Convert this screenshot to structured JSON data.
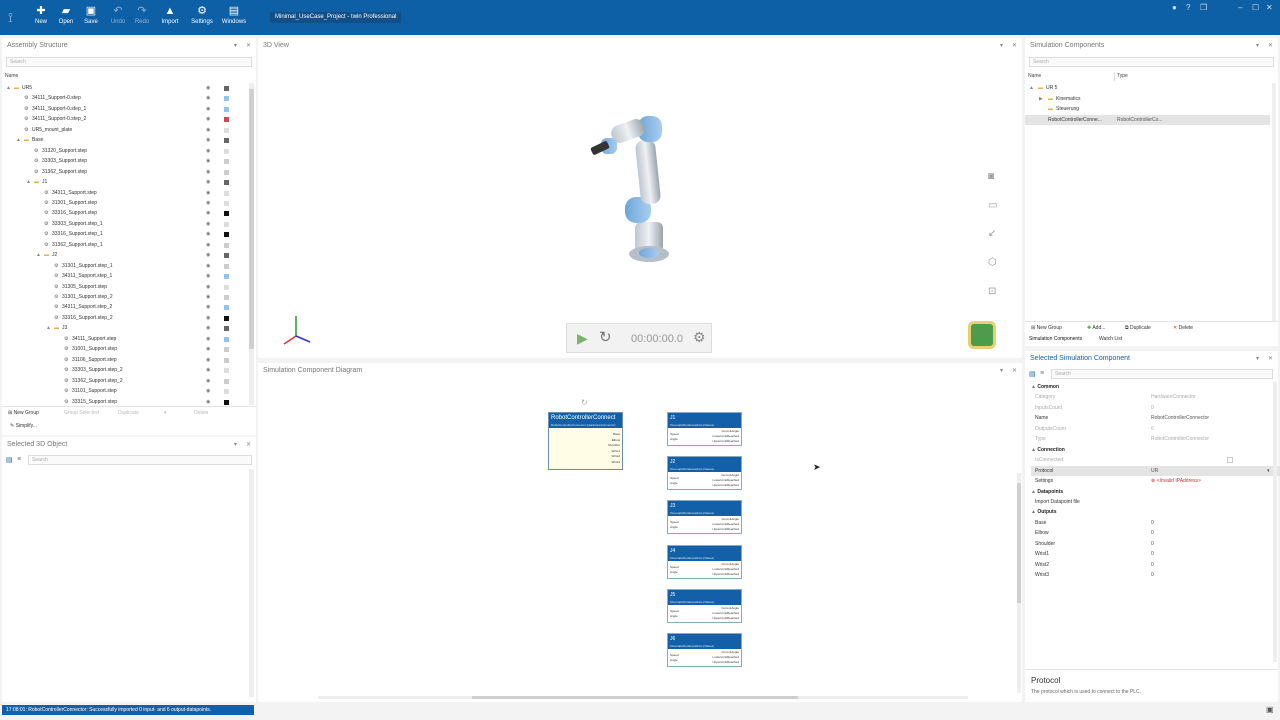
{
  "ribbon": {
    "buttons": [
      {
        "label": "New",
        "icon": "new-icon",
        "glyph": "✚"
      },
      {
        "label": "Open",
        "icon": "folder-icon",
        "glyph": "▰"
      },
      {
        "label": "Save",
        "icon": "save-icon",
        "glyph": "▣"
      },
      {
        "label": "Undo",
        "icon": "undo-icon",
        "glyph": "↶"
      },
      {
        "label": "Redo",
        "icon": "redo-icon",
        "glyph": "↷"
      },
      {
        "label": "Import",
        "icon": "import-icon",
        "glyph": "▲"
      },
      {
        "label": "Settings",
        "icon": "gear-icon",
        "glyph": "⚙"
      },
      {
        "label": "Windows",
        "icon": "windows-icon",
        "glyph": "▤"
      }
    ],
    "title": "Minimal_UseCase_Project - twin Professional"
  },
  "assembly": {
    "title": "Assembly Structure",
    "search_placeholder": "Search",
    "col_name": "Name",
    "rows": [
      {
        "label": "UR5",
        "depth": 0,
        "twisty": "▲",
        "type": "folder",
        "color": "#666666"
      },
      {
        "label": "34111_Support-0.step",
        "depth": 1,
        "twisty": "",
        "type": "part",
        "color": "#8ec4f0"
      },
      {
        "label": "34111_Support-0.step_1",
        "depth": 1,
        "twisty": "",
        "type": "part",
        "color": "#8ec4f0"
      },
      {
        "label": "34111_Support-0.step_2",
        "depth": 1,
        "twisty": "",
        "type": "part",
        "color": "#c05050"
      },
      {
        "label": "UR5_mount_plate",
        "depth": 1,
        "twisty": "",
        "type": "part",
        "color": "#dddddd"
      },
      {
        "label": "Base",
        "depth": 1,
        "twisty": "▲",
        "type": "folder",
        "color": "#666666"
      },
      {
        "label": "31320_Support.step",
        "depth": 2,
        "twisty": "",
        "type": "part",
        "color": "#dddddd"
      },
      {
        "label": "33303_Support.step",
        "depth": 2,
        "twisty": "",
        "type": "part",
        "color": "#cccccc"
      },
      {
        "label": "31362_Support.step",
        "depth": 2,
        "twisty": "",
        "type": "part",
        "color": "#cccccc"
      },
      {
        "label": "J1",
        "depth": 2,
        "twisty": "▲",
        "type": "folder",
        "color": "#666666"
      },
      {
        "label": "34311_Support.step",
        "depth": 3,
        "twisty": "",
        "type": "part",
        "color": "#dddddd"
      },
      {
        "label": "31301_Support.step",
        "depth": 3,
        "twisty": "",
        "type": "part",
        "color": "#dddddd"
      },
      {
        "label": "33316_Support.step",
        "depth": 3,
        "twisty": "",
        "type": "part",
        "color": "#111111"
      },
      {
        "label": "33303_Support.step_1",
        "depth": 3,
        "twisty": "",
        "type": "part",
        "color": "#dddddd"
      },
      {
        "label": "33316_Support.step_1",
        "depth": 3,
        "twisty": "",
        "type": "part",
        "color": "#111111"
      },
      {
        "label": "31362_Support.step_1",
        "depth": 3,
        "twisty": "",
        "type": "part",
        "color": "#cccccc"
      },
      {
        "label": "J2",
        "depth": 3,
        "twisty": "▲",
        "type": "folder",
        "color": "#666666"
      },
      {
        "label": "31301_Support.step_1",
        "depth": 4,
        "twisty": "",
        "type": "part",
        "color": "#cccccc"
      },
      {
        "label": "34311_Support.step_1",
        "depth": 4,
        "twisty": "",
        "type": "part",
        "color": "#8ec4f0"
      },
      {
        "label": "31305_Support.step",
        "depth": 4,
        "twisty": "",
        "type": "part",
        "color": "#dddddd"
      },
      {
        "label": "31301_Support.step_2",
        "depth": 4,
        "twisty": "",
        "type": "part",
        "color": "#cccccc"
      },
      {
        "label": "34311_Support.step_2",
        "depth": 4,
        "twisty": "",
        "type": "part",
        "color": "#8ec4f0"
      },
      {
        "label": "33316_Support.step_2",
        "depth": 4,
        "twisty": "",
        "type": "part",
        "color": "#111111"
      },
      {
        "label": "J3",
        "depth": 4,
        "twisty": "▲",
        "type": "folder",
        "color": "#666666"
      },
      {
        "label": "34111_Support.step",
        "depth": 5,
        "twisty": "",
        "type": "part",
        "color": "#8ec4f0"
      },
      {
        "label": "31001_Support.step",
        "depth": 5,
        "twisty": "",
        "type": "part",
        "color": "#cccccc"
      },
      {
        "label": "31106_Support.step",
        "depth": 5,
        "twisty": "",
        "type": "part",
        "color": "#cccccc"
      },
      {
        "label": "33303_Support.step_2",
        "depth": 5,
        "twisty": "",
        "type": "part",
        "color": "#dddddd"
      },
      {
        "label": "31362_Support.step_2",
        "depth": 5,
        "twisty": "",
        "type": "part",
        "color": "#cccccc"
      },
      {
        "label": "31101_Support.step",
        "depth": 5,
        "twisty": "",
        "type": "part",
        "color": "#dddddd"
      },
      {
        "label": "33315_Support.step",
        "depth": 5,
        "twisty": "",
        "type": "part",
        "color": "#111111"
      }
    ],
    "toolbar": {
      "new_group": "New Group",
      "group_selected": "Group Selected",
      "duplicate": "Duplicate",
      "delete": "Delete",
      "simplify": "Simplify..."
    }
  },
  "selected3d": {
    "title": "Selected 3D Object",
    "search_placeholder": "Search"
  },
  "view3d": {
    "title": "3D View",
    "time": "00:00:00.0"
  },
  "diagram": {
    "title": "Simulation Component Diagram",
    "controller": {
      "title": "RobotControllerConnect",
      "subtitle": "RobotControllerConnector (HardwareConnector)",
      "outputs": [
        "Base",
        "Elbow",
        "Shoulder",
        "Wrist1",
        "Wrist2",
        "Wrist3"
      ]
    },
    "joints": [
      {
        "title": "J1",
        "subtitle": "KinematicRotationalAxis (Values)"
      },
      {
        "title": "J2",
        "subtitle": "KinematicRotationalAxis (Values)"
      },
      {
        "title": "J3",
        "subtitle": "KinematicRotationalAxis (Values)"
      },
      {
        "title": "J4",
        "subtitle": "KinematicRotationalAxis (Values)"
      },
      {
        "title": "J5",
        "subtitle": "KinematicRotationalAxis (Values)"
      },
      {
        "title": "J6",
        "subtitle": "KinematicRotationalAxis (Values)"
      }
    ],
    "joint_inputs": [
      "Speed",
      "Angle"
    ],
    "joint_outputs": [
      "CurrentAngle",
      "LowerLimitReached",
      "UpperLimitReached"
    ]
  },
  "simcomp": {
    "title": "Simulation Components",
    "search_placeholder": "Search",
    "col_name": "Name",
    "col_type": "Type",
    "rows": [
      {
        "name": "UR 5",
        "type": "",
        "depth": 0,
        "twisty": "▲",
        "folder": true,
        "selected": false
      },
      {
        "name": "Kinematics",
        "type": "",
        "depth": 1,
        "twisty": "▶",
        "folder": true,
        "selected": false
      },
      {
        "name": "Steuerung",
        "type": "",
        "depth": 1,
        "twisty": "",
        "folder": true,
        "selected": false
      },
      {
        "name": "RobotControllerConne...",
        "type": "RobotControllerCo...",
        "depth": 1,
        "twisty": "",
        "folder": false,
        "selected": true
      }
    ],
    "toolbar": {
      "new_group": "New Group",
      "add": "Add...",
      "duplicate": "Duplicate",
      "delete": "Delete"
    },
    "tabs": [
      "Simulation Components",
      "Watch List"
    ]
  },
  "selcomp": {
    "title": "Selected Simulation Component",
    "search_placeholder": "Search",
    "rows": [
      {
        "kind": "cat",
        "label": "Common"
      },
      {
        "kind": "prop",
        "key": "Category",
        "value": "HardwareConnector",
        "dim": true
      },
      {
        "kind": "prop",
        "key": "InputsCount",
        "value": "0",
        "dim": true
      },
      {
        "kind": "prop",
        "key": "Name",
        "value": "RobotControllerConnector",
        "dim": false
      },
      {
        "kind": "prop",
        "key": "OutputsCount",
        "value": "6",
        "dim": true
      },
      {
        "kind": "prop",
        "key": "Type",
        "value": "RobotControllerConnector",
        "dim": true
      },
      {
        "kind": "cat",
        "label": "Connection"
      },
      {
        "kind": "prop",
        "key": "IsConnected",
        "value": "",
        "dim": true
      },
      {
        "kind": "prop",
        "key": "Protocol",
        "value": "UR",
        "dim": false,
        "selected": true
      },
      {
        "kind": "prop",
        "key": "Settings",
        "value": "⊗ <Invalid IPAddress>",
        "dim": false
      },
      {
        "kind": "cat",
        "label": "Datapoints"
      },
      {
        "kind": "prop",
        "key": "Import Datapoint file",
        "value": "",
        "dim": false
      },
      {
        "kind": "cat",
        "label": "Outputs"
      },
      {
        "kind": "prop",
        "key": "Base",
        "value": "0",
        "dim": false
      },
      {
        "kind": "prop",
        "key": "Elbow",
        "value": "0",
        "dim": false
      },
      {
        "kind": "prop",
        "key": "Shoulder",
        "value": "0",
        "dim": false
      },
      {
        "kind": "prop",
        "key": "Wrist1",
        "value": "0",
        "dim": false
      },
      {
        "kind": "prop",
        "key": "Wrist2",
        "value": "0",
        "dim": false
      },
      {
        "kind": "prop",
        "key": "Wrist3",
        "value": "0",
        "dim": false
      }
    ],
    "desc_title": "Protocol",
    "desc_text": "The protocol which is used to connect to the PLC."
  },
  "status": {
    "text": "17:08:01: RobotControllerConnector: Successfully imported 0 input- and 6 output-datapoints."
  },
  "colors": {
    "ribbon": "#0d5fa6",
    "node_header": "#1460a8",
    "controller_fill": "#fffde6"
  }
}
